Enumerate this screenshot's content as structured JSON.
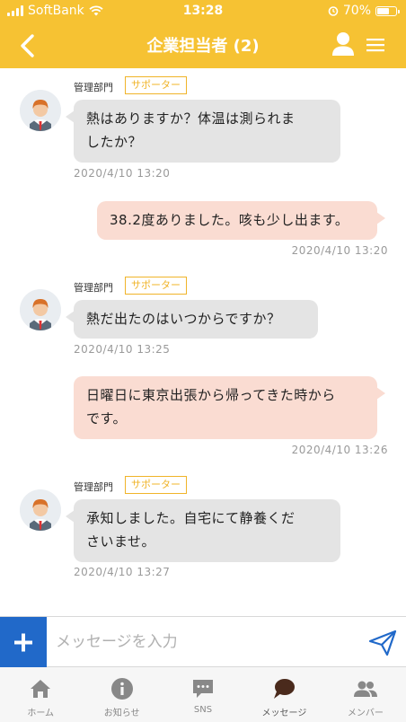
{
  "status_bar": {
    "carrier": "SoftBank",
    "time": "13:28",
    "battery": "70%",
    "battery_level": 0.7
  },
  "header": {
    "title": "企業担当者 (2)",
    "back_icon": "chevron-left-icon",
    "user_icon": "person-icon",
    "menu_icon": "hamburger-icon"
  },
  "messages": [
    {
      "direction": "in",
      "sender": "管理部門",
      "role": "サポーター",
      "lines": [
        "熱はありますか？体温は測られま",
        "したか？"
      ],
      "time": "2020/4/10 13:20"
    },
    {
      "direction": "out",
      "lines": [
        "38.2度ありました。咳も少し出ます。"
      ],
      "time": "2020/4/10 13:20"
    },
    {
      "direction": "in",
      "sender": "管理部門",
      "role": "サポーター",
      "lines": [
        "熱だ出たのはいつからですか？"
      ],
      "time": "2020/4/10 13:25"
    },
    {
      "direction": "out",
      "lines": [
        "日曜日に東京出張から帰ってきた時から",
        "です。"
      ],
      "time": "2020/4/10 13:26"
    },
    {
      "direction": "in",
      "sender": "管理部門",
      "role": "サポーター",
      "lines": [
        "承知しました。自宅にて静養くだ",
        "さいませ。"
      ],
      "time": "2020/4/10 13:27"
    }
  ],
  "composer": {
    "placeholder": "メッセージを入力",
    "value": "",
    "plus_icon": "plus-icon",
    "send_icon": "send-icon"
  },
  "tabs": [
    {
      "label": "ホーム",
      "icon": "home-icon"
    },
    {
      "label": "お知らせ",
      "icon": "info-icon"
    },
    {
      "label": "SNS",
      "icon": "chat-bubble-icon"
    },
    {
      "label": "メッセージ",
      "icon": "message-icon",
      "active": true
    },
    {
      "label": "メンバー",
      "icon": "members-icon"
    }
  ],
  "colors": {
    "header": "#f6c233",
    "incoming_bubble": "#e4e4e4",
    "outgoing_bubble": "#fadcd2",
    "badge": "#f0b429",
    "plus_button": "#2169c9",
    "active_tab_icon": "#4a2a1c"
  }
}
